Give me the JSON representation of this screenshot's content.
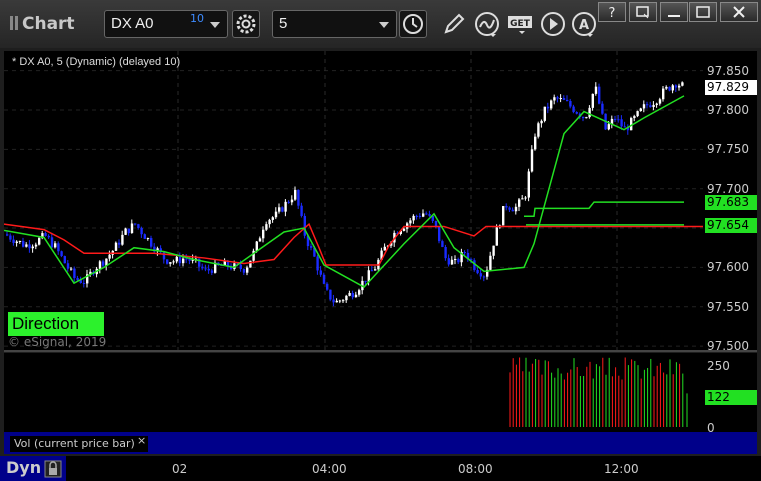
{
  "toolbar": {
    "title": "Chart",
    "symbol": "DX A0",
    "symbol_badge": "10",
    "interval": "5",
    "icons": [
      "settings-gear-icon",
      "clock-icon",
      "pencil-draw-icon",
      "indicator-curve-icon",
      "get-data-icon",
      "play-icon",
      "text-tool-icon"
    ],
    "window_buttons": [
      "question-icon",
      "restore-window-icon",
      "minimize-icon",
      "maximize-icon",
      "close-icon"
    ]
  },
  "chart": {
    "study_label": "* DX A0, 5 (Dynamic) (delayed 10)",
    "direction_label": "Direction",
    "copyright": "© eSignal, 2019",
    "last_price": "97.829",
    "green_upper_value": "97.683",
    "green_lower_value": "97.654",
    "y_ticks": [
      "97.850",
      "97.800",
      "97.750",
      "97.700",
      "97.650",
      "97.600",
      "97.550",
      "97.500"
    ],
    "x_ticks": [
      "02",
      "04:00",
      "08:00",
      "12:00"
    ],
    "colors": {
      "up_candle": "#ffffff",
      "down_candle": "#1a2bff",
      "red_line": "#ff1a1a",
      "green_line": "#22e022",
      "tag_bg": "#22e022",
      "direction_bg": "#2cf12c"
    }
  },
  "volume": {
    "label": "Vol (current price bar)",
    "close_symbol": "×",
    "y_ticks": [
      "250",
      "0"
    ],
    "current_value": "122"
  },
  "footer": {
    "dyn_label": "Dyn"
  },
  "chart_data": {
    "type": "candlestick",
    "y_axis_ticks": [
      97.5,
      97.55,
      97.6,
      97.65,
      97.7,
      97.75,
      97.8,
      97.85
    ],
    "ylim": [
      97.495,
      97.875
    ],
    "x_axis_ticks": [
      "02",
      "04:00",
      "08:00",
      "12:00"
    ],
    "close_path": [
      [
        0,
        97.642
      ],
      [
        10,
        97.635
      ],
      [
        20,
        97.628
      ],
      [
        30,
        97.632
      ],
      [
        40,
        97.64
      ],
      [
        50,
        97.626
      ],
      [
        60,
        97.605
      ],
      [
        70,
        97.585
      ],
      [
        80,
        97.582
      ],
      [
        90,
        97.6
      ],
      [
        100,
        97.61
      ],
      [
        110,
        97.625
      ],
      [
        120,
        97.645
      ],
      [
        130,
        97.655
      ],
      [
        140,
        97.64
      ],
      [
        150,
        97.625
      ],
      [
        160,
        97.61
      ],
      [
        170,
        97.608
      ],
      [
        180,
        97.612
      ],
      [
        190,
        97.606
      ],
      [
        200,
        97.595
      ],
      [
        210,
        97.6
      ],
      [
        220,
        97.603
      ],
      [
        230,
        97.6
      ],
      [
        240,
        97.598
      ],
      [
        250,
        97.622
      ],
      [
        260,
        97.66
      ],
      [
        270,
        97.665
      ],
      [
        280,
        97.68
      ],
      [
        290,
        97.695
      ],
      [
        300,
        97.64
      ],
      [
        310,
        97.61
      ],
      [
        320,
        97.57
      ],
      [
        330,
        97.555
      ],
      [
        340,
        97.562
      ],
      [
        350,
        97.57
      ],
      [
        360,
        97.585
      ],
      [
        370,
        97.6
      ],
      [
        380,
        97.625
      ],
      [
        390,
        97.645
      ],
      [
        400,
        97.655
      ],
      [
        410,
        97.665
      ],
      [
        420,
        97.67
      ],
      [
        430,
        97.652
      ],
      [
        440,
        97.612
      ],
      [
        450,
        97.605
      ],
      [
        460,
        97.62
      ],
      [
        470,
        97.6
      ],
      [
        480,
        97.59
      ],
      [
        490,
        97.64
      ],
      [
        500,
        97.68
      ],
      [
        510,
        97.675
      ],
      [
        520,
        97.69
      ],
      [
        530,
        97.77
      ],
      [
        540,
        97.8
      ],
      [
        550,
        97.815
      ],
      [
        560,
        97.81
      ],
      [
        570,
        97.8
      ],
      [
        580,
        97.79
      ],
      [
        590,
        97.83
      ],
      [
        600,
        97.775
      ],
      [
        610,
        97.79
      ],
      [
        620,
        97.775
      ],
      [
        630,
        97.79
      ],
      [
        640,
        97.805
      ],
      [
        650,
        97.812
      ],
      [
        660,
        97.825
      ],
      [
        670,
        97.835
      ],
      [
        680,
        97.829
      ]
    ],
    "red_line": [
      [
        0,
        97.655
      ],
      [
        40,
        97.648
      ],
      [
        60,
        97.635
      ],
      [
        80,
        97.618
      ],
      [
        150,
        97.618
      ],
      [
        200,
        97.612
      ],
      [
        240,
        97.605
      ],
      [
        270,
        97.61
      ],
      [
        290,
        97.638
      ],
      [
        305,
        97.655
      ],
      [
        315,
        97.625
      ],
      [
        322,
        97.603
      ],
      [
        375,
        97.603
      ],
      [
        385,
        97.628
      ],
      [
        400,
        97.652
      ],
      [
        440,
        97.652
      ],
      [
        470,
        97.64
      ],
      [
        482,
        97.652
      ],
      [
        700,
        97.652
      ]
    ],
    "green_line": [
      [
        0,
        97.647
      ],
      [
        40,
        97.638
      ],
      [
        70,
        97.58
      ],
      [
        100,
        97.6
      ],
      [
        130,
        97.625
      ],
      [
        160,
        97.62
      ],
      [
        190,
        97.61
      ],
      [
        230,
        97.6
      ],
      [
        280,
        97.645
      ],
      [
        300,
        97.65
      ],
      [
        320,
        97.603
      ],
      [
        360,
        97.575
      ],
      [
        400,
        97.63
      ],
      [
        430,
        97.668
      ],
      [
        450,
        97.625
      ],
      [
        480,
        97.595
      ],
      [
        520,
        97.6
      ],
      [
        530,
        97.63
      ],
      [
        545,
        97.7
      ],
      [
        560,
        97.77
      ],
      [
        580,
        97.798
      ],
      [
        620,
        97.775
      ],
      [
        640,
        97.79
      ],
      [
        680,
        97.818
      ]
    ],
    "green_upper_step": [
      [
        0,
        null
      ],
      [
        520,
        97.665
      ],
      [
        530,
        97.665
      ],
      [
        531,
        97.675
      ],
      [
        585,
        97.675
      ],
      [
        590,
        97.683
      ],
      [
        680,
        97.683
      ]
    ],
    "green_flat_level": 97.654,
    "volume_max": 250,
    "volume_current": 122
  }
}
